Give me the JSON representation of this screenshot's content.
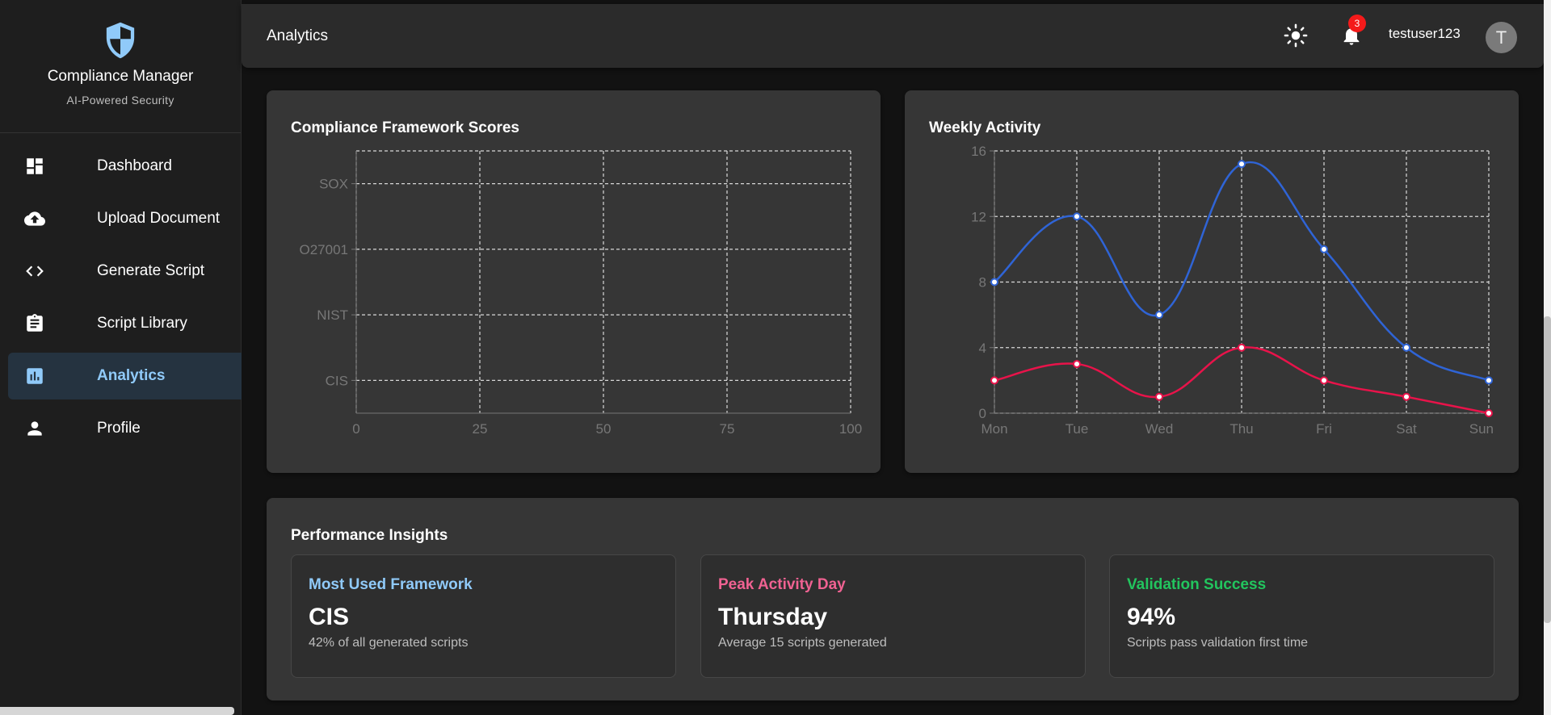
{
  "brand": {
    "title": "Compliance Manager",
    "subtitle": "AI-Powered Security"
  },
  "sidebar": {
    "items": [
      {
        "label": "Dashboard",
        "icon": "dashboard-icon"
      },
      {
        "label": "Upload Document",
        "icon": "cloud-upload-icon"
      },
      {
        "label": "Generate Script",
        "icon": "code-icon"
      },
      {
        "label": "Script Library",
        "icon": "clipboard-icon"
      },
      {
        "label": "Analytics",
        "icon": "bar-chart-icon",
        "active": true
      },
      {
        "label": "Profile",
        "icon": "person-icon"
      }
    ]
  },
  "header": {
    "title": "Analytics",
    "notification_count": "3",
    "username": "testuser123",
    "avatar_initial": "T"
  },
  "colors": {
    "accent": "#90caf9",
    "blue_series": "#2f64d6",
    "red_series": "#e8134a",
    "framework_label": "#90caf9",
    "peak_label": "#f06292",
    "validation_label": "#22c55e"
  },
  "frameworks_card": {
    "title": "Compliance Framework Scores"
  },
  "weekly_card": {
    "title": "Weekly Activity"
  },
  "chart_data": [
    {
      "type": "bar",
      "orientation": "horizontal",
      "title": "Compliance Framework Scores",
      "categories": [
        "SOX",
        "O27001",
        "NIST",
        "CIS"
      ],
      "values": [],
      "x_ticks": [
        "0",
        "25",
        "50",
        "75",
        "100"
      ],
      "xlim": [
        0,
        100
      ],
      "grid": true
    },
    {
      "type": "line",
      "title": "Weekly Activity",
      "categories": [
        "Mon",
        "Tue",
        "Wed",
        "Thu",
        "Fri",
        "Sat",
        "Sun"
      ],
      "y_ticks": [
        "0",
        "4",
        "8",
        "12",
        "16"
      ],
      "ylim": [
        0,
        16
      ],
      "grid": true,
      "series": [
        {
          "values": [
            8,
            12,
            6,
            15.2,
            10,
            4,
            2
          ],
          "color": "#2f64d6"
        },
        {
          "values": [
            2,
            3,
            1,
            4,
            2,
            1,
            0
          ],
          "color": "#e8134a"
        }
      ]
    }
  ],
  "insights": {
    "title": "Performance Insights",
    "cards": [
      {
        "heading": "Most Used Framework",
        "value": "CIS",
        "sub": "42% of all generated scripts"
      },
      {
        "heading": "Peak Activity Day",
        "value": "Thursday",
        "sub": "Average 15 scripts generated"
      },
      {
        "heading": "Validation Success",
        "value": "94%",
        "sub": "Scripts pass validation first time"
      }
    ]
  }
}
